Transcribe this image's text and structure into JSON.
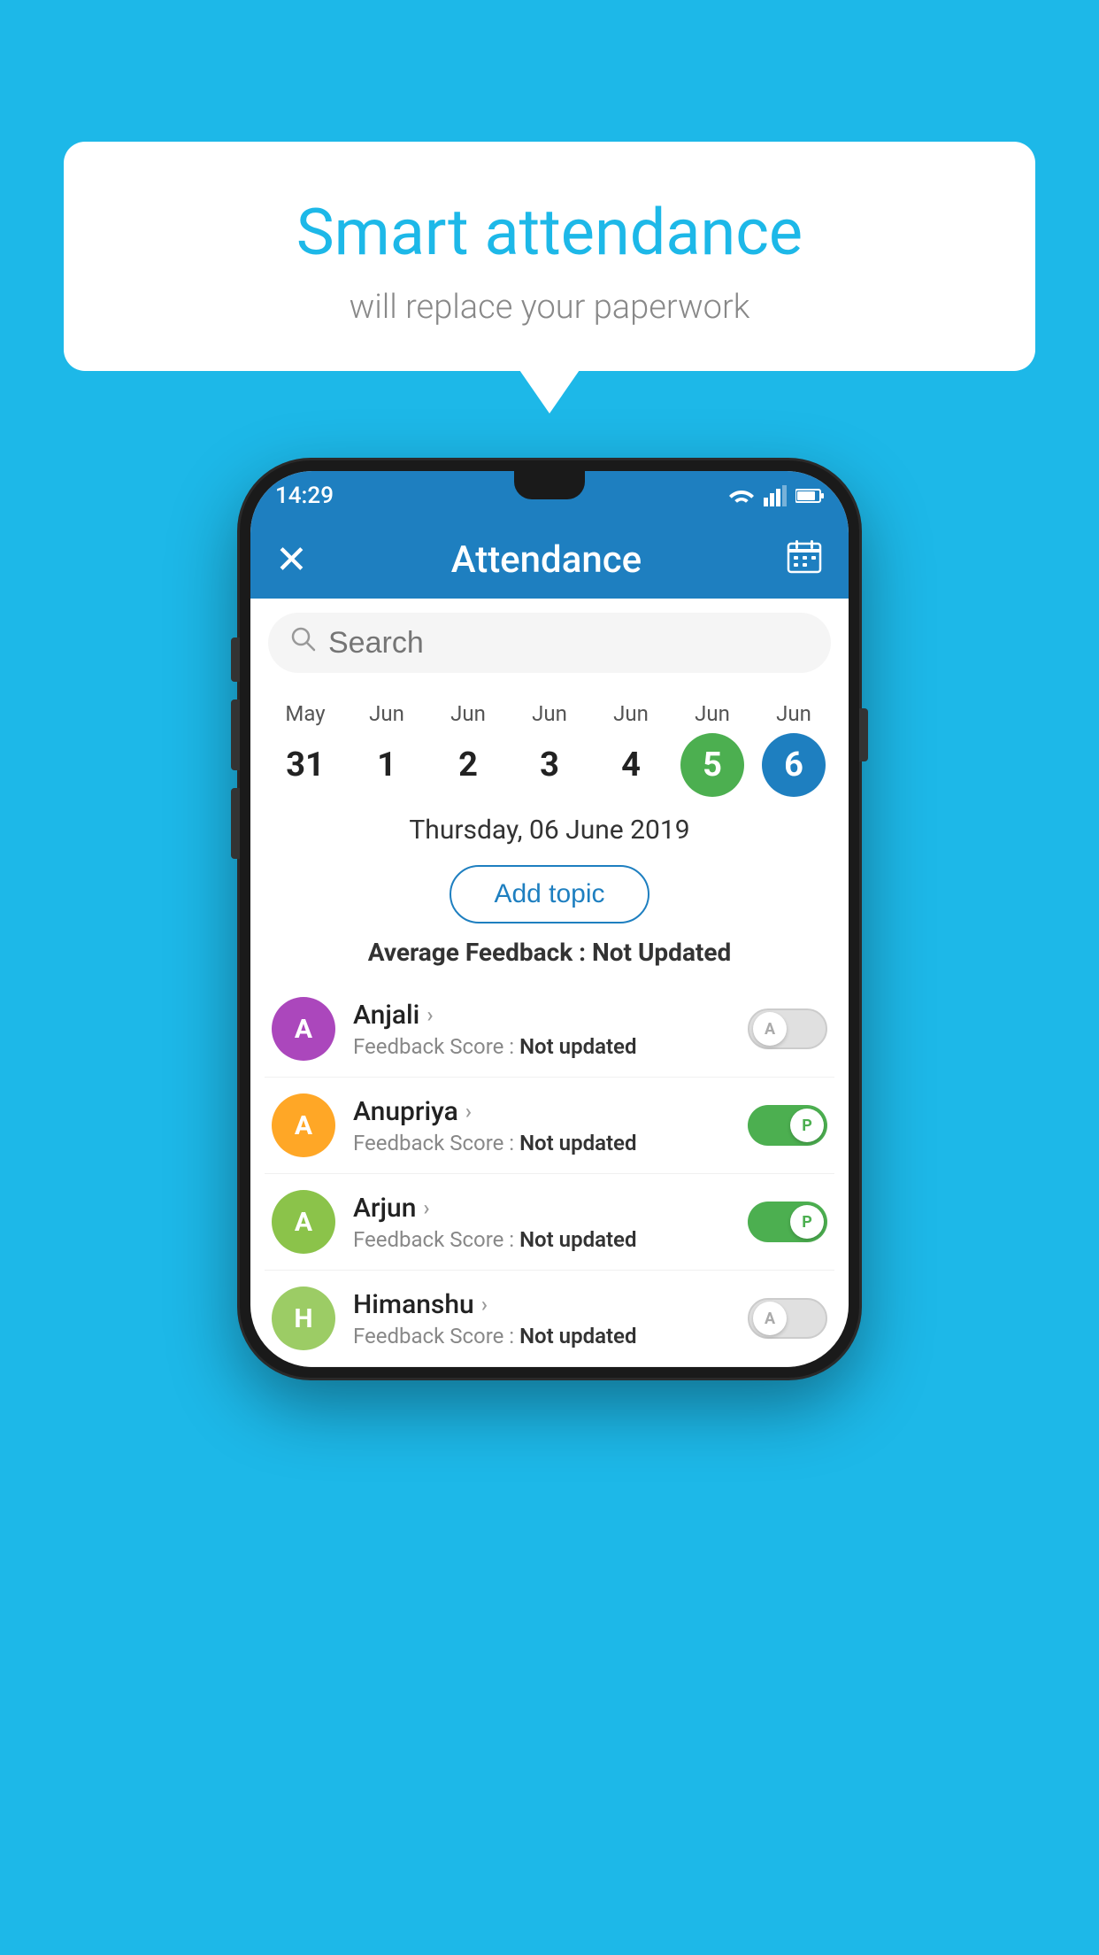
{
  "background_color": "#1db8e8",
  "bubble": {
    "title": "Smart attendance",
    "subtitle": "will replace your paperwork"
  },
  "phone": {
    "status_bar": {
      "time": "14:29",
      "icons": [
        "wifi",
        "signal",
        "battery"
      ]
    },
    "app_bar": {
      "title": "Attendance",
      "close_label": "×",
      "calendar_icon": "calendar"
    },
    "search": {
      "placeholder": "Search"
    },
    "calendar": {
      "days": [
        {
          "month": "May",
          "date": "31",
          "state": "normal"
        },
        {
          "month": "Jun",
          "date": "1",
          "state": "normal"
        },
        {
          "month": "Jun",
          "date": "2",
          "state": "normal"
        },
        {
          "month": "Jun",
          "date": "3",
          "state": "normal"
        },
        {
          "month": "Jun",
          "date": "4",
          "state": "normal"
        },
        {
          "month": "Jun",
          "date": "5",
          "state": "today"
        },
        {
          "month": "Jun",
          "date": "6",
          "state": "selected"
        }
      ]
    },
    "selected_date_label": "Thursday, 06 June 2019",
    "add_topic_label": "Add topic",
    "avg_feedback_label": "Average Feedback :",
    "avg_feedback_value": "Not Updated",
    "students": [
      {
        "name": "Anjali",
        "avatar_letter": "A",
        "avatar_color": "#ab47bc",
        "feedback_label": "Feedback Score :",
        "feedback_value": "Not updated",
        "toggle_state": "off",
        "toggle_letter": "A"
      },
      {
        "name": "Anupriya",
        "avatar_letter": "A",
        "avatar_color": "#ffa726",
        "feedback_label": "Feedback Score :",
        "feedback_value": "Not updated",
        "toggle_state": "on",
        "toggle_letter": "P"
      },
      {
        "name": "Arjun",
        "avatar_letter": "A",
        "avatar_color": "#8bc34a",
        "feedback_label": "Feedback Score :",
        "feedback_value": "Not updated",
        "toggle_state": "on",
        "toggle_letter": "P"
      },
      {
        "name": "Himanshu",
        "avatar_letter": "H",
        "avatar_color": "#9ccc65",
        "feedback_label": "Feedback Score :",
        "feedback_value": "Not updated",
        "toggle_state": "off",
        "toggle_letter": "A"
      }
    ]
  }
}
